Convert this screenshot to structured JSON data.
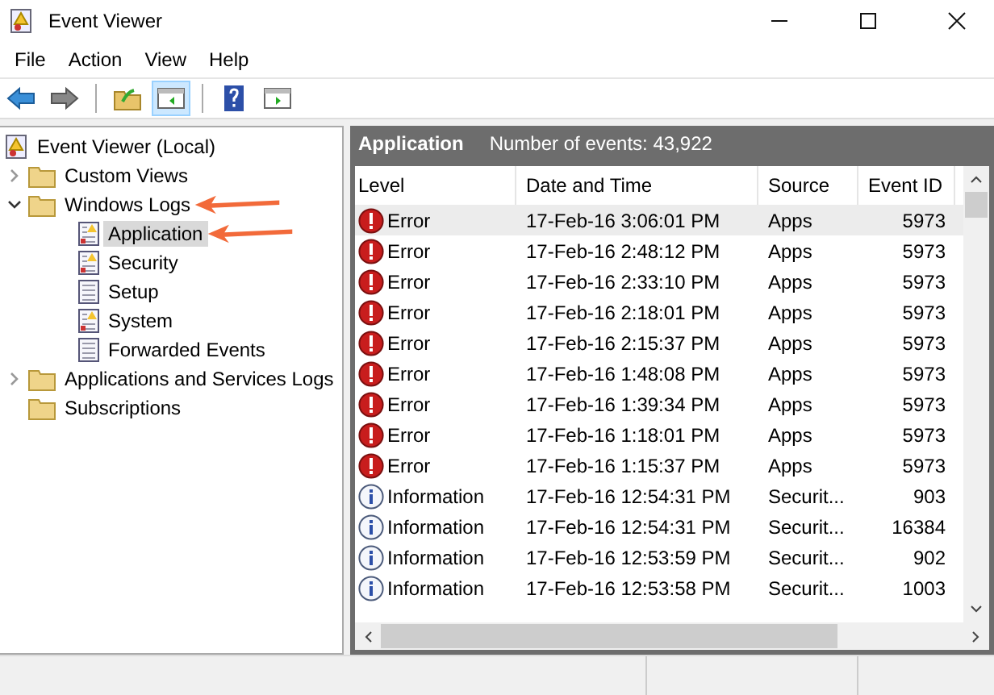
{
  "window": {
    "title": "Event Viewer"
  },
  "menu": [
    "File",
    "Action",
    "View",
    "Help"
  ],
  "toolbar": [
    {
      "kind": "back",
      "selected": false
    },
    {
      "kind": "forward",
      "selected": false
    },
    {
      "kind": "sep"
    },
    {
      "kind": "folder",
      "selected": false
    },
    {
      "kind": "pane",
      "selected": true
    },
    {
      "kind": "sep"
    },
    {
      "kind": "help",
      "selected": false
    },
    {
      "kind": "action-pane",
      "selected": false
    }
  ],
  "tree": [
    {
      "label": "Event Viewer (Local)",
      "kind": "root",
      "selected": false,
      "children": [
        {
          "label": "Custom Views",
          "kind": "folder",
          "expanded": false,
          "selected": false
        },
        {
          "label": "Windows Logs",
          "kind": "folder",
          "expanded": true,
          "selected": false,
          "arrow": true,
          "children": [
            {
              "label": "Application",
              "kind": "log-warning",
              "selected": true,
              "arrow": true
            },
            {
              "label": "Security",
              "kind": "log-warning",
              "selected": false
            },
            {
              "label": "Setup",
              "kind": "log",
              "selected": false
            },
            {
              "label": "System",
              "kind": "log-warning",
              "selected": false
            },
            {
              "label": "Forwarded Events",
              "kind": "log",
              "selected": false
            }
          ]
        },
        {
          "label": "Applications and Services Logs",
          "kind": "folder",
          "expanded": false,
          "selected": false
        },
        {
          "label": "Subscriptions",
          "kind": "folder",
          "selected": false
        }
      ]
    }
  ],
  "pane": {
    "title": "Application",
    "summary": "Number of events: 43,922"
  },
  "table": {
    "columns": [
      "Level",
      "Date and Time",
      "Source",
      "Event ID"
    ],
    "rows": [
      {
        "kind": "error",
        "level": "Error",
        "date": "17-Feb-16 3:06:01 PM",
        "source": "Apps",
        "event_id": "5973",
        "selected": true
      },
      {
        "kind": "error",
        "level": "Error",
        "date": "17-Feb-16 2:48:12 PM",
        "source": "Apps",
        "event_id": "5973",
        "selected": false
      },
      {
        "kind": "error",
        "level": "Error",
        "date": "17-Feb-16 2:33:10 PM",
        "source": "Apps",
        "event_id": "5973",
        "selected": false
      },
      {
        "kind": "error",
        "level": "Error",
        "date": "17-Feb-16 2:18:01 PM",
        "source": "Apps",
        "event_id": "5973",
        "selected": false
      },
      {
        "kind": "error",
        "level": "Error",
        "date": "17-Feb-16 2:15:37 PM",
        "source": "Apps",
        "event_id": "5973",
        "selected": false
      },
      {
        "kind": "error",
        "level": "Error",
        "date": "17-Feb-16 1:48:08 PM",
        "source": "Apps",
        "event_id": "5973",
        "selected": false
      },
      {
        "kind": "error",
        "level": "Error",
        "date": "17-Feb-16 1:39:34 PM",
        "source": "Apps",
        "event_id": "5973",
        "selected": false
      },
      {
        "kind": "error",
        "level": "Error",
        "date": "17-Feb-16 1:18:01 PM",
        "source": "Apps",
        "event_id": "5973",
        "selected": false
      },
      {
        "kind": "error",
        "level": "Error",
        "date": "17-Feb-16 1:15:37 PM",
        "source": "Apps",
        "event_id": "5973",
        "selected": false
      },
      {
        "kind": "information",
        "level": "Information",
        "date": "17-Feb-16 12:54:31 PM",
        "source": "Securit...",
        "event_id": "903",
        "selected": false
      },
      {
        "kind": "information",
        "level": "Information",
        "date": "17-Feb-16 12:54:31 PM",
        "source": "Securit...",
        "event_id": "16384",
        "selected": false
      },
      {
        "kind": "information",
        "level": "Information",
        "date": "17-Feb-16 12:53:59 PM",
        "source": "Securit...",
        "event_id": "902",
        "selected": false
      },
      {
        "kind": "information",
        "level": "Information",
        "date": "17-Feb-16 12:53:58 PM",
        "source": "Securit...",
        "event_id": "1003",
        "selected": false
      }
    ]
  }
}
